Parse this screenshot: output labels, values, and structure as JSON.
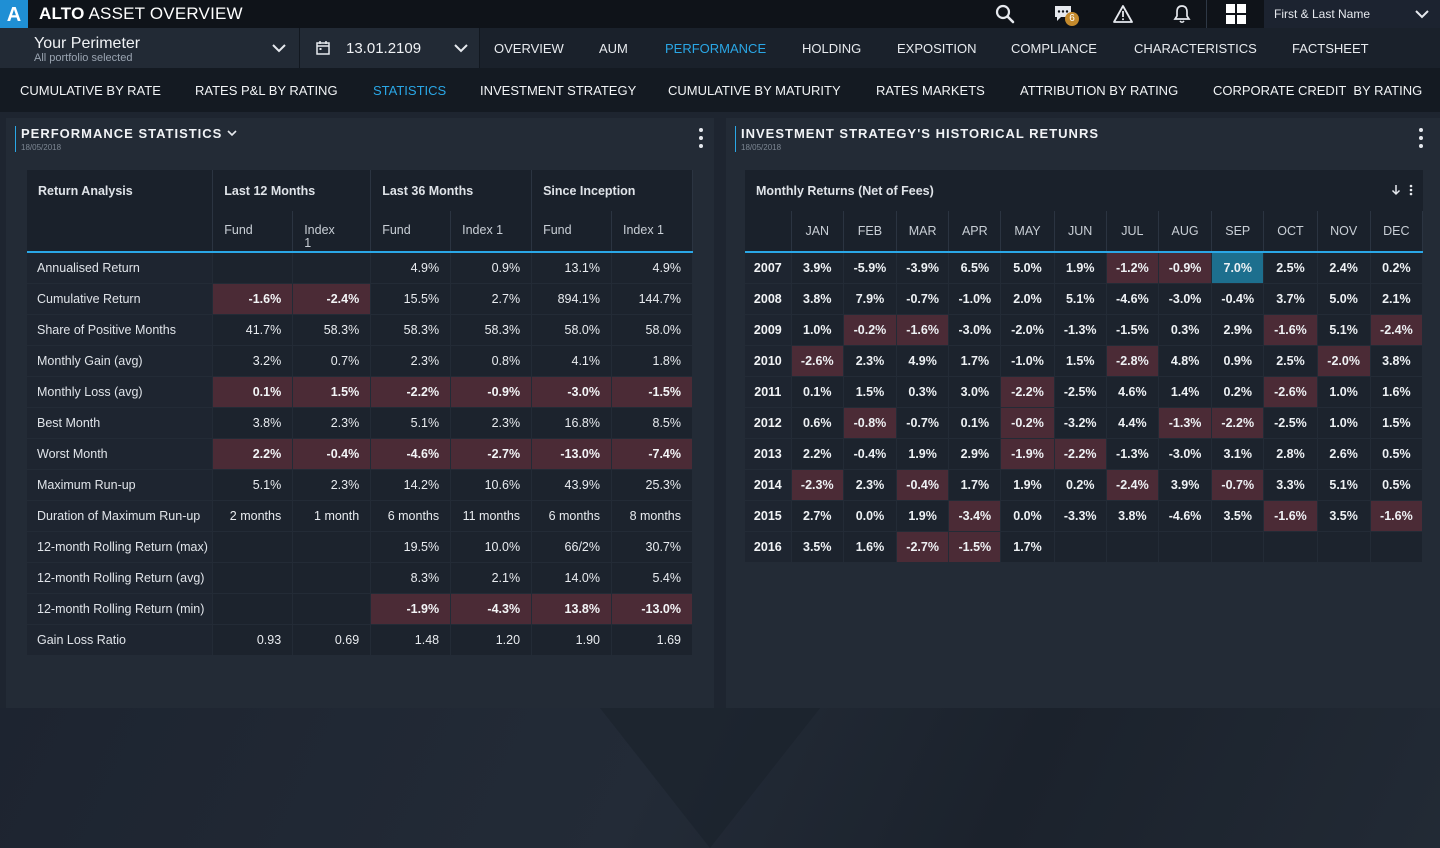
{
  "app": {
    "logo_letter": "A",
    "brand": "ALTO",
    "title": "ASSET OVERVIEW"
  },
  "topbar": {
    "notifications_badge": "6",
    "user_name": "First & Last Name"
  },
  "perimeter": {
    "title": "Your Perimeter",
    "subtitle": "All portfolio selected"
  },
  "date": {
    "value": "13.01.2109"
  },
  "main_nav": [
    "OVERVIEW",
    "AUM",
    "PERFORMANCE",
    "HOLDING",
    "EXPOSITION",
    "COMPLIANCE",
    "CHARACTERISTICS",
    "FACTSHEET"
  ],
  "main_nav_active": "PERFORMANCE",
  "sub_nav": [
    "CUMULATIVE BY RATE",
    "RATES P&L BY RATING",
    "STATISTICS",
    "INVESTMENT STRATEGY",
    "CUMULATIVE BY MATURITY",
    "RATES MARKETS",
    "ATTRIBUTION BY RATING",
    "CORPORATE CREDIT  BY RATING"
  ],
  "sub_nav_active": "STATISTICS",
  "left_panel": {
    "title": "PERFORMANCE STATISTICS",
    "date": "18/05/2018",
    "header_groups": [
      "Return Analysis",
      "Last 12 Months",
      "Last 36 Months",
      "Since Inception"
    ],
    "sub_headers": [
      "Fund",
      "Index 1",
      "Fund",
      "Index 1",
      "Fund",
      "Index 1"
    ],
    "rows": [
      {
        "label": "Annualised Return",
        "values": [
          "",
          "",
          "4.9%",
          "0.9%",
          "13.1%",
          "4.9%"
        ],
        "neg": []
      },
      {
        "label": "Cumulative Return",
        "values": [
          "-1.6%",
          "-2.4%",
          "15.5%",
          "2.7%",
          "894.1%",
          "144.7%"
        ],
        "neg": [
          0,
          1
        ]
      },
      {
        "label": "Share of Positive Months",
        "values": [
          "41.7%",
          "58.3%",
          "58.3%",
          "58.3%",
          "58.0%",
          "58.0%"
        ],
        "neg": []
      },
      {
        "label": "Monthly Gain (avg)",
        "values": [
          "3.2%",
          "0.7%",
          "2.3%",
          "0.8%",
          "4.1%",
          "1.8%"
        ],
        "neg": []
      },
      {
        "label": "Monthly Loss (avg)",
        "values": [
          "0.1%",
          "1.5%",
          "-2.2%",
          "-0.9%",
          "-3.0%",
          "-1.5%"
        ],
        "neg": [
          0,
          1,
          2,
          3,
          4,
          5
        ]
      },
      {
        "label": "Best Month",
        "values": [
          "3.8%",
          "2.3%",
          "5.1%",
          "2.3%",
          "16.8%",
          "8.5%"
        ],
        "neg": []
      },
      {
        "label": "Worst Month",
        "values": [
          "2.2%",
          "-0.4%",
          "-4.6%",
          "-2.7%",
          "-13.0%",
          "-7.4%"
        ],
        "neg": [
          0,
          1,
          2,
          3,
          4,
          5
        ]
      },
      {
        "label": "Maximum Run-up",
        "values": [
          "5.1%",
          "2.3%",
          "14.2%",
          "10.6%",
          "43.9%",
          "25.3%"
        ],
        "neg": []
      },
      {
        "label": "Duration of Maximum Run-up",
        "values": [
          "2 months",
          "1 month",
          "6 months",
          "11 months",
          "6 months",
          "8 months"
        ],
        "neg": []
      },
      {
        "label": "12-month Rolling Return (max)",
        "values": [
          "",
          "",
          "19.5%",
          "10.0%",
          "66/2%",
          "30.7%"
        ],
        "neg": []
      },
      {
        "label": "12-month Rolling Return (avg)",
        "values": [
          "",
          "",
          "8.3%",
          "2.1%",
          "14.0%",
          "5.4%"
        ],
        "neg": []
      },
      {
        "label": "12-month Rolling Return (min)",
        "values": [
          "",
          "",
          "-1.9%",
          "-4.3%",
          "13.8%",
          "-13.0%"
        ],
        "neg": [
          2,
          3,
          4,
          5
        ]
      },
      {
        "label": "Gain Loss Ratio",
        "values": [
          "0.93",
          "0.69",
          "1.48",
          "1.20",
          "1.90",
          "1.69"
        ],
        "neg": []
      }
    ]
  },
  "right_panel": {
    "title": "INVESTMENT STRATEGY'S HISTORICAL RETUNRS",
    "date": "18/05/2018",
    "table_title": "Monthly Returns (Net of Fees)",
    "months": [
      "JAN",
      "FEB",
      "MAR",
      "APR",
      "MAY",
      "JUN",
      "JUL",
      "AUG",
      "SEP",
      "OCT",
      "NOV",
      "DEC"
    ],
    "rows": [
      {
        "year": "2007",
        "values": [
          "3.9%",
          "-5.9%",
          "-3.9%",
          "6.5%",
          "5.0%",
          "1.9%",
          "-1.2%",
          "-0.9%",
          "7.0%",
          "2.5%",
          "2.4%",
          "0.2%"
        ],
        "neg": [
          6,
          7
        ],
        "hl": [
          8
        ]
      },
      {
        "year": "2008",
        "values": [
          "3.8%",
          "7.9%",
          "-0.7%",
          "-1.0%",
          "2.0%",
          "5.1%",
          "-4.6%",
          "-3.0%",
          "-0.4%",
          "3.7%",
          "5.0%",
          "2.1%"
        ],
        "neg": [],
        "hl": []
      },
      {
        "year": "2009",
        "values": [
          "1.0%",
          "-0.2%",
          "-1.6%",
          "-3.0%",
          "-2.0%",
          "-1.3%",
          "-1.5%",
          "0.3%",
          "2.9%",
          "-1.6%",
          "5.1%",
          "-2.4%"
        ],
        "neg": [
          1,
          2,
          9,
          11
        ],
        "hl": []
      },
      {
        "year": "2010",
        "values": [
          "-2.6%",
          "2.3%",
          "4.9%",
          "1.7%",
          "-1.0%",
          "1.5%",
          "-2.8%",
          "4.8%",
          "0.9%",
          "2.5%",
          "-2.0%",
          "3.8%"
        ],
        "neg": [
          0,
          6,
          10
        ],
        "hl": []
      },
      {
        "year": "2011",
        "values": [
          "0.1%",
          "1.5%",
          "0.3%",
          "3.0%",
          "-2.2%",
          "-2.5%",
          "4.6%",
          "1.4%",
          "0.2%",
          "-2.6%",
          "1.0%",
          "1.6%"
        ],
        "neg": [
          4,
          9
        ],
        "hl": []
      },
      {
        "year": "2012",
        "values": [
          "0.6%",
          "-0.8%",
          "-0.7%",
          "0.1%",
          "-0.2%",
          "-3.2%",
          "4.4%",
          "-1.3%",
          "-2.2%",
          "-2.5%",
          "1.0%",
          "1.5%"
        ],
        "neg": [
          1,
          4,
          7,
          8
        ],
        "hl": []
      },
      {
        "year": "2013",
        "values": [
          "2.2%",
          "-0.4%",
          "1.9%",
          "2.9%",
          "-1.9%",
          "-2.2%",
          "-1.3%",
          "-3.0%",
          "3.1%",
          "2.8%",
          "2.6%",
          "0.5%"
        ],
        "neg": [
          4,
          5
        ],
        "hl": []
      },
      {
        "year": "2014",
        "values": [
          "-2.3%",
          "2.3%",
          "-0.4%",
          "1.7%",
          "1.9%",
          "0.2%",
          "-2.4%",
          "3.9%",
          "-0.7%",
          "3.3%",
          "5.1%",
          "0.5%"
        ],
        "neg": [
          0,
          2,
          6,
          8
        ],
        "hl": []
      },
      {
        "year": "2015",
        "values": [
          "2.7%",
          "0.0%",
          "1.9%",
          "-3.4%",
          "0.0%",
          "-3.3%",
          "3.8%",
          "-4.6%",
          "3.5%",
          "-1.6%",
          "3.5%",
          "-1.6%"
        ],
        "neg": [
          3,
          9,
          11
        ],
        "hl": []
      },
      {
        "year": "2016",
        "values": [
          "3.5%",
          "1.6%",
          "-2.7%",
          "-1.5%",
          "1.7%",
          "",
          "",
          "",
          "",
          "",
          "",
          ""
        ],
        "neg": [
          2,
          3
        ],
        "hl": []
      }
    ]
  },
  "colors": {
    "accent": "#2aa7e6",
    "negative_cell": "#4b2b36",
    "highlight_cell": "#1d6f8e",
    "badge": "#c48a2c"
  }
}
